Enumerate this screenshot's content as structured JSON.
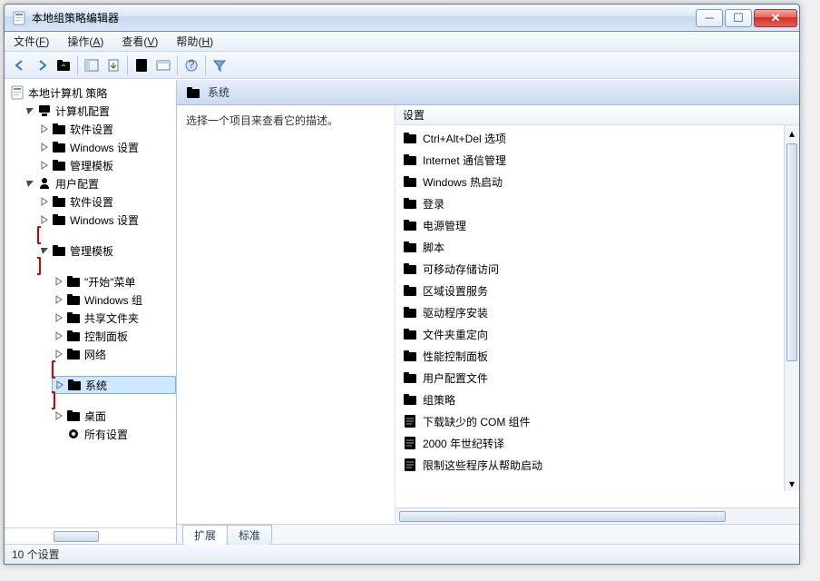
{
  "window": {
    "title": "本地组策略编辑器"
  },
  "menubar": [
    {
      "label": "文件",
      "accel": "F"
    },
    {
      "label": "操作",
      "accel": "A"
    },
    {
      "label": "查看",
      "accel": "V"
    },
    {
      "label": "帮助",
      "accel": "H"
    }
  ],
  "toolbar_icons": [
    "back",
    "forward",
    "up",
    "show-hide-tree",
    "export-list",
    "delete",
    "properties",
    "refresh",
    "help",
    "sep",
    "filter"
  ],
  "tree": {
    "root": {
      "label": "本地计算机 策略"
    },
    "computer": {
      "label": "计算机配置",
      "children": [
        {
          "label": "软件设置"
        },
        {
          "label": "Windows 设置"
        },
        {
          "label": "管理模板"
        }
      ]
    },
    "user": {
      "label": "用户配置",
      "software": {
        "label": "软件设置"
      },
      "windows": {
        "label": "Windows 设置"
      },
      "admin": {
        "label": "管理模板",
        "children": [
          {
            "label": "\"开始\"菜单"
          },
          {
            "label": "Windows 组"
          },
          {
            "label": "共享文件夹"
          },
          {
            "label": "控制面板"
          },
          {
            "label": "网络"
          },
          {
            "label": "系统",
            "selected": true,
            "highlight": true
          },
          {
            "label": "桌面"
          },
          {
            "label": "所有设置",
            "icon": "gear"
          }
        ]
      }
    }
  },
  "detail": {
    "header": "系统",
    "description": "选择一个项目来查看它的描述。",
    "column_header": "设置",
    "items": [
      {
        "label": "Ctrl+Alt+Del 选项",
        "icon": "folder"
      },
      {
        "label": "Internet 通信管理",
        "icon": "folder"
      },
      {
        "label": "Windows 热启动",
        "icon": "folder"
      },
      {
        "label": "登录",
        "icon": "folder"
      },
      {
        "label": "电源管理",
        "icon": "folder"
      },
      {
        "label": "脚本",
        "icon": "folder"
      },
      {
        "label": "可移动存储访问",
        "icon": "folder"
      },
      {
        "label": "区域设置服务",
        "icon": "folder"
      },
      {
        "label": "驱动程序安装",
        "icon": "folder"
      },
      {
        "label": "文件夹重定向",
        "icon": "folder"
      },
      {
        "label": "性能控制面板",
        "icon": "folder"
      },
      {
        "label": "用户配置文件",
        "icon": "folder"
      },
      {
        "label": "组策略",
        "icon": "folder"
      },
      {
        "label": "下载缺少的 COM 组件",
        "icon": "policy"
      },
      {
        "label": "2000 年世纪转译",
        "icon": "policy"
      },
      {
        "label": "限制这些程序从帮助启动",
        "icon": "policy"
      }
    ]
  },
  "tabs": [
    {
      "label": "扩展",
      "active": true
    },
    {
      "label": "标准",
      "active": false
    }
  ],
  "statusbar": "10 个设置"
}
